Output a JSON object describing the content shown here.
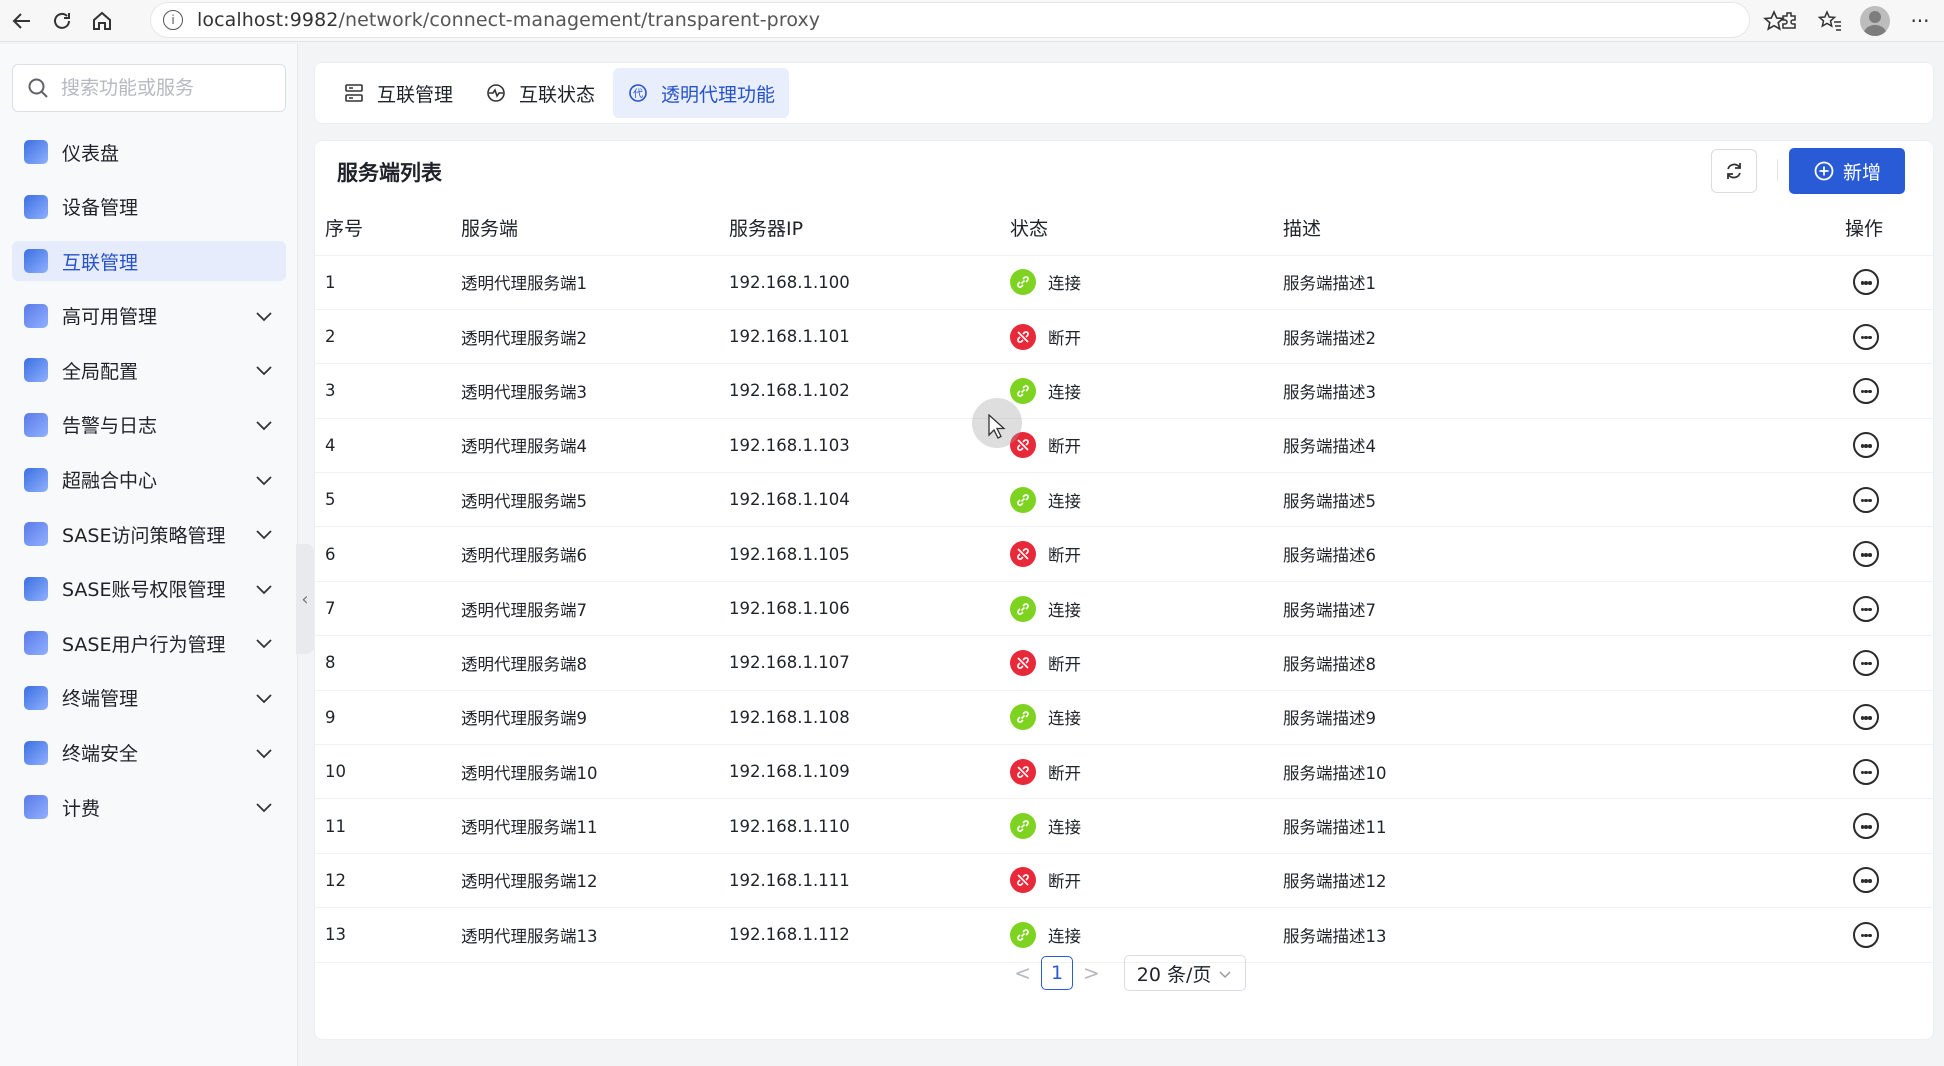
{
  "browser": {
    "url_host": "localhost:9982",
    "url_path": "/network/connect-management/transparent-proxy"
  },
  "sidebar": {
    "search_placeholder": "搜索功能或服务",
    "items": [
      {
        "label": "仪表盘",
        "icon": "dashboard-icon",
        "expandable": false,
        "active": false
      },
      {
        "label": "设备管理",
        "icon": "device-icon",
        "expandable": false,
        "active": false
      },
      {
        "label": "互联管理",
        "icon": "network-icon",
        "expandable": false,
        "active": true
      },
      {
        "label": "高可用管理",
        "icon": "ha-icon",
        "expandable": true,
        "active": false
      },
      {
        "label": "全局配置",
        "icon": "global-config-icon",
        "expandable": true,
        "active": false
      },
      {
        "label": "告警与日志",
        "icon": "alarm-icon",
        "expandable": true,
        "active": false
      },
      {
        "label": "超融合中心",
        "icon": "hci-icon",
        "expandable": true,
        "active": false
      },
      {
        "label": "SASE访问策略管理",
        "icon": "sase-policy-icon",
        "expandable": true,
        "active": false
      },
      {
        "label": "SASE账号权限管理",
        "icon": "sase-account-icon",
        "expandable": true,
        "active": false
      },
      {
        "label": "SASE用户行为管理",
        "icon": "sase-behavior-icon",
        "expandable": true,
        "active": false
      },
      {
        "label": "终端管理",
        "icon": "terminal-icon",
        "expandable": true,
        "active": false
      },
      {
        "label": "终端安全",
        "icon": "terminal-security-icon",
        "expandable": true,
        "active": false
      },
      {
        "label": "计费",
        "icon": "billing-icon",
        "expandable": true,
        "active": false
      }
    ]
  },
  "tabs": [
    {
      "label": "互联管理",
      "active": false
    },
    {
      "label": "互联状态",
      "active": false
    },
    {
      "label": "透明代理功能",
      "active": true
    }
  ],
  "panel": {
    "title": "服务端列表",
    "add_label": "新增"
  },
  "table": {
    "columns": [
      "序号",
      "服务端",
      "服务器IP",
      "状态",
      "描述",
      "操作"
    ],
    "rows": [
      {
        "idx": "1",
        "name": "透明代理服务端1",
        "ip": "192.168.1.100",
        "status": "连接",
        "ok": true,
        "desc": "服务端描述1"
      },
      {
        "idx": "2",
        "name": "透明代理服务端2",
        "ip": "192.168.1.101",
        "status": "断开",
        "ok": false,
        "desc": "服务端描述2"
      },
      {
        "idx": "3",
        "name": "透明代理服务端3",
        "ip": "192.168.1.102",
        "status": "连接",
        "ok": true,
        "desc": "服务端描述3"
      },
      {
        "idx": "4",
        "name": "透明代理服务端4",
        "ip": "192.168.1.103",
        "status": "断开",
        "ok": false,
        "desc": "服务端描述4"
      },
      {
        "idx": "5",
        "name": "透明代理服务端5",
        "ip": "192.168.1.104",
        "status": "连接",
        "ok": true,
        "desc": "服务端描述5"
      },
      {
        "idx": "6",
        "name": "透明代理服务端6",
        "ip": "192.168.1.105",
        "status": "断开",
        "ok": false,
        "desc": "服务端描述6"
      },
      {
        "idx": "7",
        "name": "透明代理服务端7",
        "ip": "192.168.1.106",
        "status": "连接",
        "ok": true,
        "desc": "服务端描述7"
      },
      {
        "idx": "8",
        "name": "透明代理服务端8",
        "ip": "192.168.1.107",
        "status": "断开",
        "ok": false,
        "desc": "服务端描述8"
      },
      {
        "idx": "9",
        "name": "透明代理服务端9",
        "ip": "192.168.1.108",
        "status": "连接",
        "ok": true,
        "desc": "服务端描述9"
      },
      {
        "idx": "10",
        "name": "透明代理服务端10",
        "ip": "192.168.1.109",
        "status": "断开",
        "ok": false,
        "desc": "服务端描述10"
      },
      {
        "idx": "11",
        "name": "透明代理服务端11",
        "ip": "192.168.1.110",
        "status": "连接",
        "ok": true,
        "desc": "服务端描述11"
      },
      {
        "idx": "12",
        "name": "透明代理服务端12",
        "ip": "192.168.1.111",
        "status": "断开",
        "ok": false,
        "desc": "服务端描述12"
      },
      {
        "idx": "13",
        "name": "透明代理服务端13",
        "ip": "192.168.1.112",
        "status": "连接",
        "ok": true,
        "desc": "服务端描述13"
      }
    ]
  },
  "pagination": {
    "prev": "<",
    "current": "1",
    "next": ">",
    "page_size": "20 条/页"
  },
  "colors": {
    "accent": "#2a5bd7",
    "active_bg": "#e6ecfb",
    "ok": "#7ed321",
    "off": "#e8293a"
  }
}
